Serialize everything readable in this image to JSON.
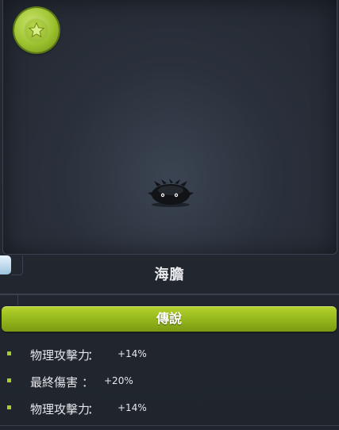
{
  "item": {
    "name": "海膽",
    "rarity": "傳說",
    "badge_icon": "star-icon",
    "preview_icon": "sea-urchin-monster-icon"
  },
  "stats": [
    {
      "name": "物理攻擊力",
      "sep": "：",
      "value": "+14%"
    },
    {
      "name": "最終傷害",
      "sep": "：",
      "value": "+20%"
    },
    {
      "name": "物理攻擊力",
      "sep": "：",
      "value": "+14%"
    }
  ],
  "colors": {
    "accent": "#9cc22e",
    "background": "#1f242c",
    "rarity_bar": "#93b51c"
  }
}
